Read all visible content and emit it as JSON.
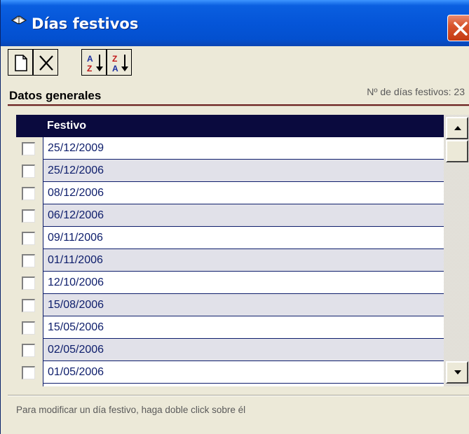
{
  "window": {
    "title": "Días festivos",
    "title_icon": "book-icon",
    "close_icon": "close-icon"
  },
  "toolbar": {
    "buttons": [
      {
        "name": "new-button",
        "icon": "new-document-icon"
      },
      {
        "name": "delete-button",
        "icon": "delete-x-icon"
      },
      {
        "name": "sort-ascending-button",
        "icon": "sort-az-icon"
      },
      {
        "name": "sort-descending-button",
        "icon": "sort-za-icon"
      }
    ]
  },
  "section": {
    "title": "Datos generales",
    "count_label": "Nº de días festivos:",
    "count_value": "23"
  },
  "grid": {
    "column_header": "Festivo",
    "rows": [
      "25/12/2009",
      "25/12/2006",
      "08/12/2006",
      "06/12/2006",
      "09/11/2006",
      "01/11/2006",
      "12/10/2006",
      "15/08/2006",
      "15/05/2006",
      "02/05/2006",
      "01/05/2006"
    ]
  },
  "status": {
    "hint": "Para modificar un día festivo, haga doble click sobre él"
  },
  "colors": {
    "titlebar": "#0555d8",
    "grid_header": "#0a0a3e",
    "row_text": "#0d1d6b",
    "row_alt": "#e1e1e9"
  }
}
